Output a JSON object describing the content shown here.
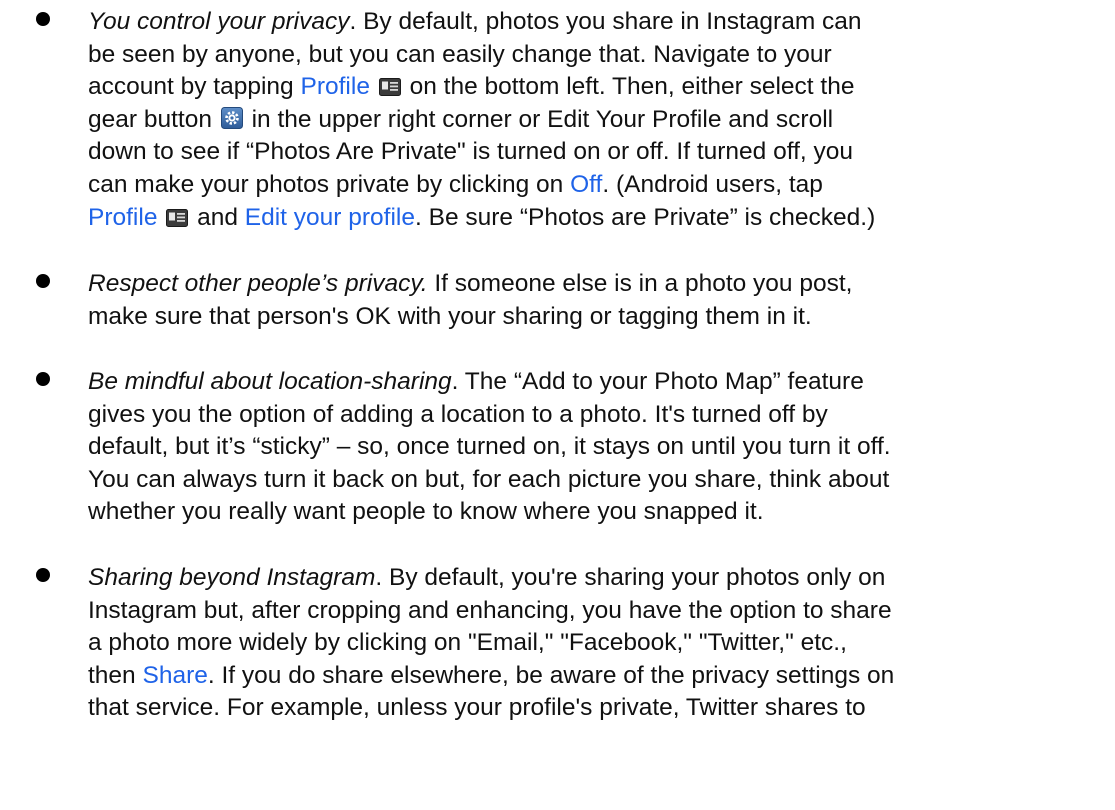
{
  "bullets": [
    {
      "lines": [
        {
          "italic": "You control your privacy",
          "text": ". By default, photos you share in Instagram can"
        },
        {
          "text": "be seen by anyone, but you can easily change that. Navigate to your"
        },
        {
          "pre": "account by tapping ",
          "link": "Profile",
          "post": " on the bottom left. Then, either select the"
        },
        {
          "pre": "gear button ",
          "post": " in the upper right corner or Edit Your Profile and scroll"
        },
        {
          "text": "down to see if “Photos Are Private\" is turned on or off. If turned off, you"
        },
        {
          "pre": "can make your photos private by clicking on ",
          "link": "Off",
          "post": ". (Android users, tap"
        },
        {
          "link": "Profile",
          "mid": " and ",
          "link2": "Edit your profile",
          "post": ". Be sure “Photos are Private” is checked.)"
        }
      ]
    },
    {
      "lines": [
        {
          "italic": "Respect other people’s privacy.",
          "text": " If someone else is in a photo you post,"
        },
        {
          "text": "make sure that person's OK with your sharing or tagging them in it."
        }
      ]
    },
    {
      "lines": [
        {
          "italic": "Be mindful about location-sharing",
          "text": ". The “Add to your Photo Map” feature"
        },
        {
          "text": "gives you the option of adding a location to a photo. It's turned off by"
        },
        {
          "text": "default, but it’s “sticky” – so, once turned on, it stays on until you turn it off."
        },
        {
          "text": "You can always turn it back on but, for each picture you share, think about"
        },
        {
          "text": "whether you really want people to know where you snapped it."
        }
      ]
    },
    {
      "lines": [
        {
          "italic": "Sharing beyond Instagram",
          "text": ". By default, you're sharing your photos only on"
        },
        {
          "text": "Instagram but, after cropping and enhancing, you have the option to share"
        },
        {
          "text": "a photo more widely by clicking on \"Email,\" \"Facebook,\" \"Twitter,\" etc.,"
        },
        {
          "pre": "then ",
          "link": "Share",
          "post": ". If you do share elsewhere, be aware of the privacy settings on"
        },
        {
          "text": "that service. For example, unless your profile's private, Twitter shares to"
        }
      ]
    }
  ],
  "icons": {
    "profile": "profile-card-icon",
    "gear": "gear-settings-icon"
  },
  "colors": {
    "link": "#1f63e8",
    "text": "#111111"
  }
}
